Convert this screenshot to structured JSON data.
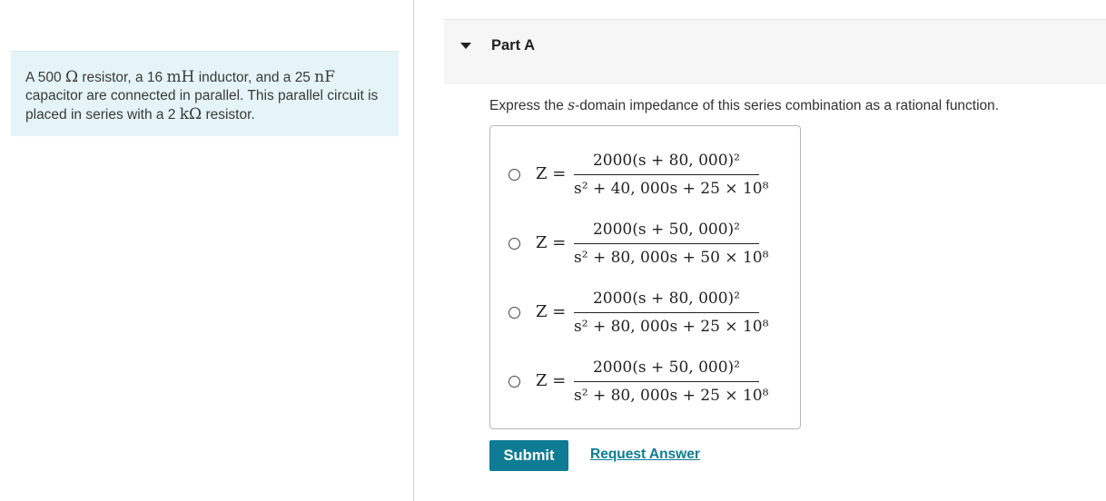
{
  "problem": {
    "text_1": "A 500 ",
    "math_1": "Ω",
    "text_2": " resistor, a 16 ",
    "math_2": "mH",
    "text_3": " inductor, and a 25 ",
    "math_3": "nF",
    "text_4": " capacitor are connected in parallel. This parallel circuit is placed in series with a 2 ",
    "math_4": "kΩ",
    "text_5": " resistor."
  },
  "part": {
    "title": "Part A"
  },
  "question": {
    "prefix": "Express the ",
    "var": "s",
    "suffix": "-domain impedance of this series combination as a rational function."
  },
  "choices": [
    {
      "lhs": "Z =",
      "numerator": "2000(s + 80, 000)²",
      "denominator": "s² + 40, 000s + 25 × 10⁸"
    },
    {
      "lhs": "Z =",
      "numerator": "2000(s + 50, 000)²",
      "denominator": "s² + 80, 000s + 50 × 10⁸"
    },
    {
      "lhs": "Z =",
      "numerator": "2000(s + 80, 000)²",
      "denominator": "s² + 80, 000s + 25 × 10⁸"
    },
    {
      "lhs": "Z =",
      "numerator": "2000(s + 50, 000)²",
      "denominator": "s² + 80, 000s + 25 × 10⁸"
    }
  ],
  "actions": {
    "submit": "Submit",
    "request": "Request Answer"
  }
}
